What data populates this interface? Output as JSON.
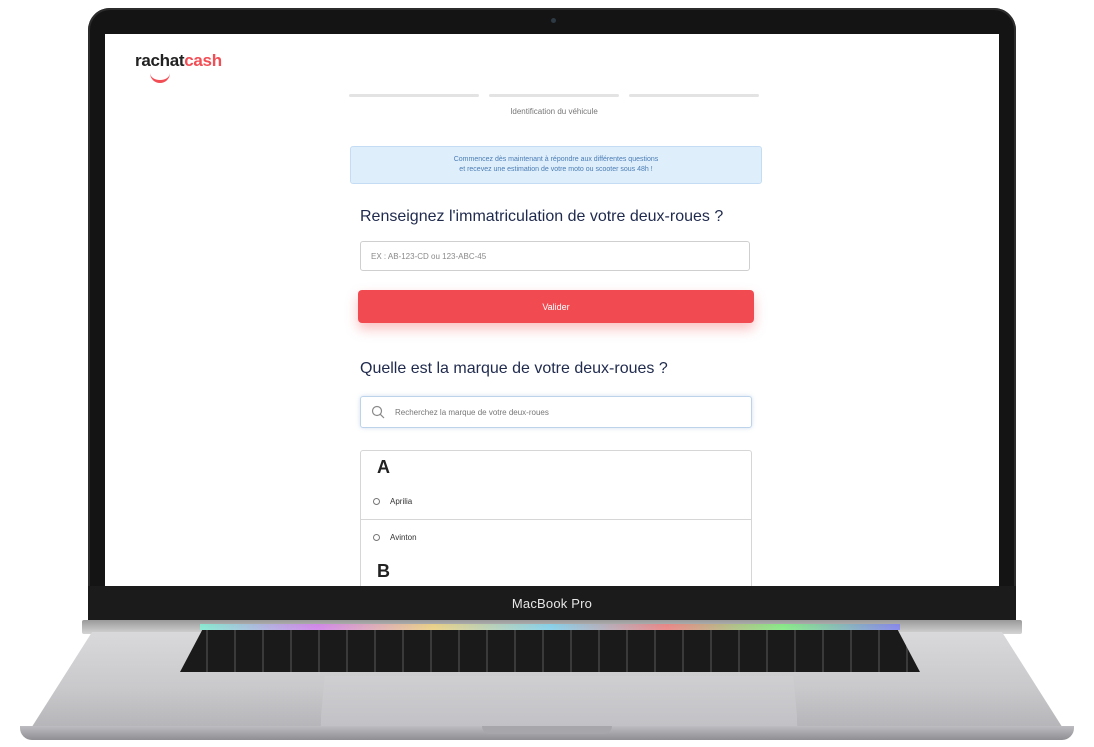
{
  "device": {
    "label": "MacBook Pro"
  },
  "header": {
    "logo_part1": "rachat",
    "logo_part2": "cash"
  },
  "progress": {
    "steps_total": 3,
    "current_step_label": "Identification du véhicule"
  },
  "info_banner": {
    "line1": "Commencez dès maintenant à répondre aux différentes questions",
    "line2": "et recevez une estimation de votre moto ou scooter sous 48h !"
  },
  "registration": {
    "question": "Renseignez l'immatriculation de votre deux-roues ?",
    "placeholder": "EX : AB-123-CD ou 123-ABC-45",
    "value": "",
    "submit_label": "Valider"
  },
  "brand": {
    "question": "Quelle est la marque de votre deux-roues ?",
    "search_placeholder": "Recherchez la marque de votre deux-roues",
    "groups": [
      {
        "letter": "A",
        "items": [
          "Aprilia",
          "Avinton"
        ]
      },
      {
        "letter": "B",
        "items": []
      }
    ]
  },
  "colors": {
    "accent": "#f14b51",
    "title": "#1f2a4d",
    "info_bg": "#dfeefb",
    "info_text": "#4a7db5"
  }
}
